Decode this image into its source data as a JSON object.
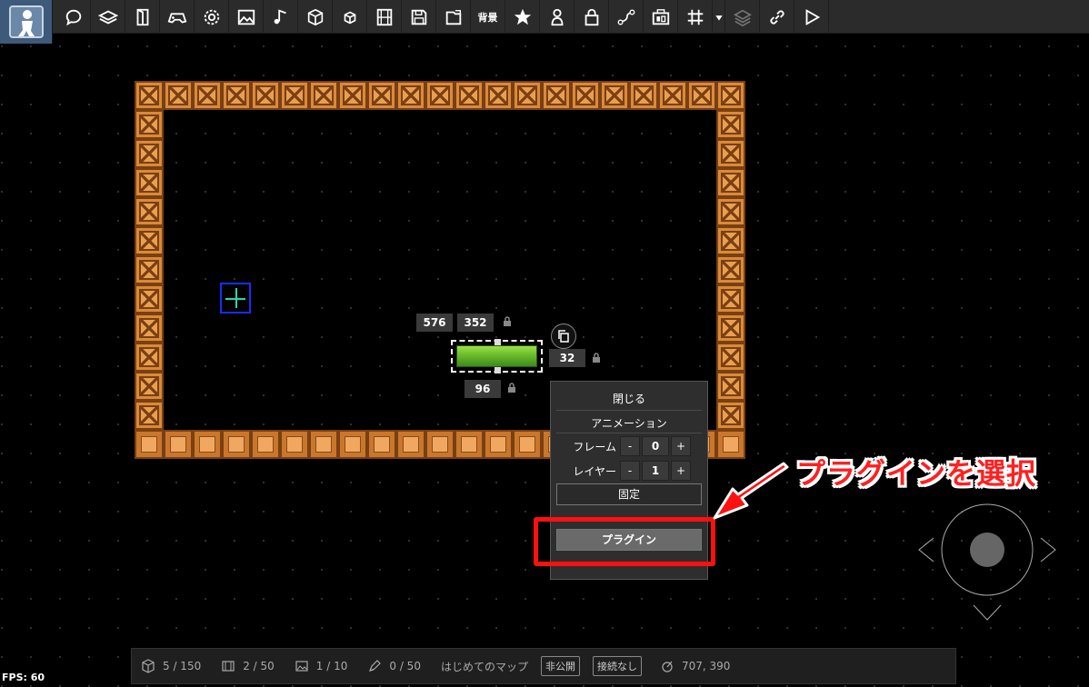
{
  "toolbar": {
    "icons": [
      "editor-logo-icon",
      "speech-bubble-icon",
      "stack-icon",
      "door-icon",
      "gamepad-icon",
      "gear-icon",
      "image-icon",
      "music-note-icon",
      "cube-icon",
      "small-cube-icon",
      "film-icon",
      "floppy-disk-icon",
      "export-icon",
      "star-icon",
      "person-icon",
      "lock-icon",
      "path-icon",
      "switch-icon",
      "grid-icon",
      "caret-down-icon",
      "layers-icon",
      "link-icon",
      "play-icon"
    ],
    "background_label": "背景"
  },
  "selection": {
    "x": "576",
    "y": "352",
    "height": "32",
    "width": "96"
  },
  "context_menu": {
    "close": "閉じる",
    "animation_header": "アニメーション",
    "frame_label": "フレーム",
    "frame_value": "0",
    "layer_label": "レイヤー",
    "layer_value": "1",
    "minus": "-",
    "plus": "+",
    "fixed": "固定",
    "plugin": "プラグイン"
  },
  "annotation": {
    "callout": "プラグインを選択",
    "highlight_color": "#ff1010"
  },
  "status": {
    "objects": "5 / 150",
    "films": "2 / 50",
    "images": "1 / 10",
    "pens": "0 / 50",
    "map_name": "はじめてのマップ",
    "visibility": "非公開",
    "connection": "接続なし",
    "coords": "707, 390"
  },
  "fps": "FPS: 60"
}
